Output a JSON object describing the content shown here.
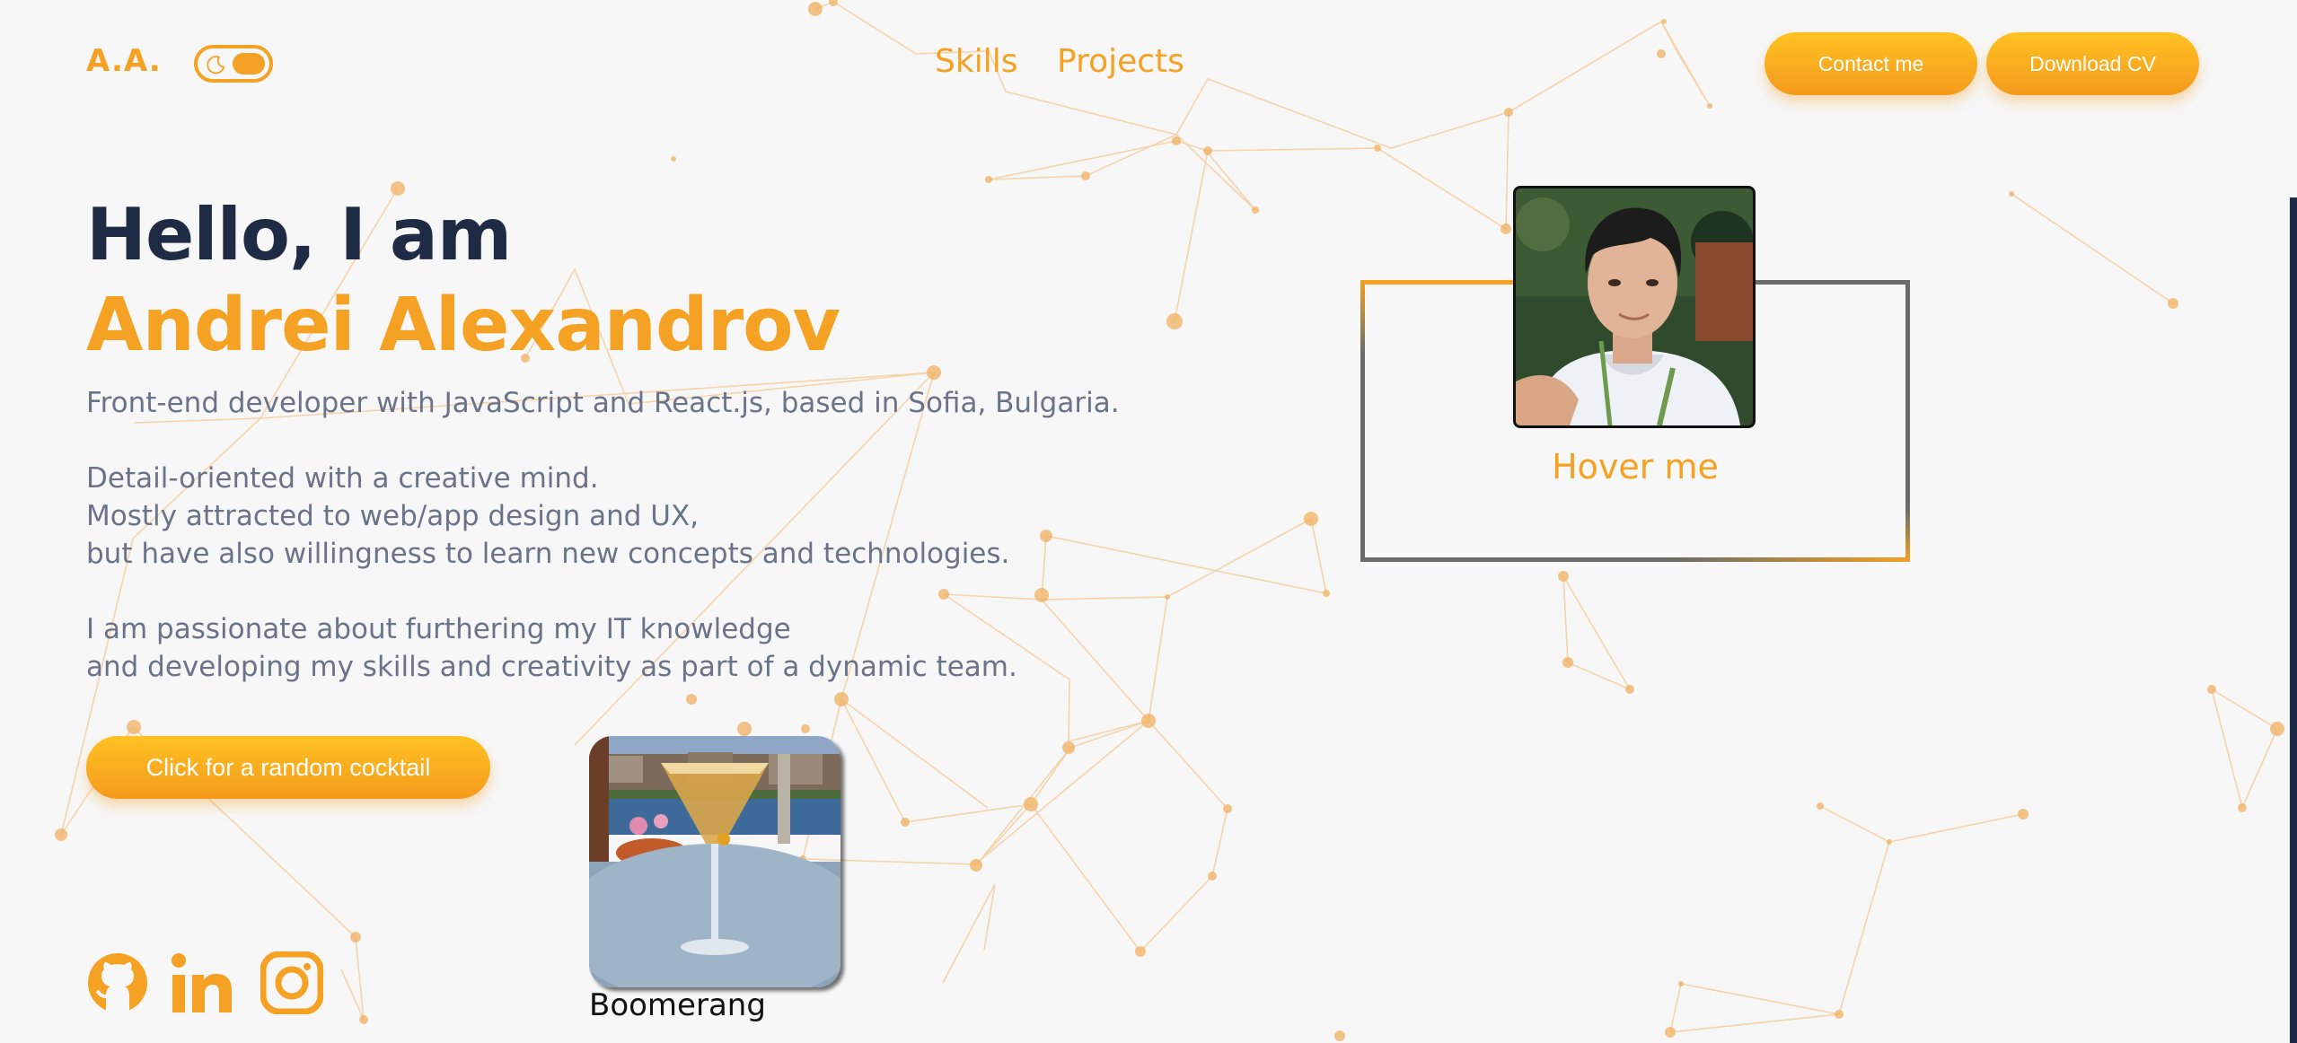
{
  "header": {
    "logo": "A.A.",
    "nav": [
      {
        "label": "Skills"
      },
      {
        "label": "Projects"
      }
    ],
    "contact_label": "Contact me",
    "download_label": "Download CV"
  },
  "hero": {
    "greeting": "Hello, I am",
    "name": "Andrei Alexandrov",
    "bio_lines": [
      "Front-end developer with JavaScript and React.js, based in Sofia, Bulgaria.",
      "Detail-oriented with a creative mind.",
      "Mostly attracted to web/app design and UX,",
      "but have also willingness to learn new concepts and technologies.",
      "I am passionate about furthering my IT knowledge",
      "and developing my skills and creativity as part of a dynamic team."
    ]
  },
  "cocktail": {
    "button_label": "Click for a random cocktail",
    "drink_name": "Boomerang"
  },
  "profile": {
    "hover_label": "Hover me"
  },
  "social": [
    "github-icon",
    "linkedin-icon",
    "instagram-icon"
  ],
  "colors": {
    "accent": "#f4a124",
    "heading": "#1f2a44",
    "body_text": "#6a7388",
    "background": "#f7f7f7",
    "card_border": "#6b6e68"
  }
}
